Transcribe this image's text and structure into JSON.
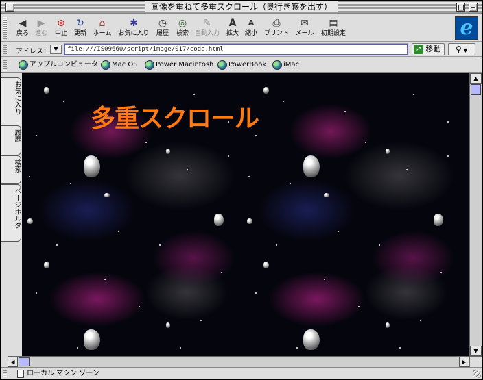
{
  "window": {
    "title": "画像を重ねて多重スクロール（奥行き感を出す）"
  },
  "toolbar": {
    "buttons": [
      {
        "label": "戻る",
        "icon": "back-arrow",
        "enabled": true
      },
      {
        "label": "進む",
        "icon": "forward-arrow",
        "enabled": false
      },
      {
        "label": "中止",
        "icon": "stop",
        "enabled": true
      },
      {
        "label": "更新",
        "icon": "refresh",
        "enabled": true
      },
      {
        "label": "ホーム",
        "icon": "home",
        "enabled": true
      },
      {
        "label": "お気に入り",
        "icon": "favorites",
        "enabled": true
      },
      {
        "label": "履歴",
        "icon": "history",
        "enabled": true
      },
      {
        "label": "検索",
        "icon": "search",
        "enabled": true
      },
      {
        "label": "自動入力",
        "icon": "autofill",
        "enabled": false
      },
      {
        "label": "拡大",
        "icon": "text-larger",
        "enabled": true
      },
      {
        "label": "縮小",
        "icon": "text-smaller",
        "enabled": true
      },
      {
        "label": "プリント",
        "icon": "print",
        "enabled": true
      },
      {
        "label": "メール",
        "icon": "mail",
        "enabled": true
      },
      {
        "label": "初期設定",
        "icon": "preferences",
        "enabled": true
      }
    ]
  },
  "address": {
    "label": "アドレス：",
    "url": "file:///IS09660/script/image/017/code.html",
    "go_label": "移動"
  },
  "favorites_bar": {
    "items": [
      "アップルコンピュータ",
      "Mac OS",
      "Power Macintosh",
      "PowerBook",
      "iMac"
    ]
  },
  "sidebar_tabs": [
    "お気に入り",
    "履歴",
    "検索",
    "ページホルダ"
  ],
  "page": {
    "heading": "多重スクロール",
    "heading_color": "#ff7a12"
  },
  "status": {
    "zone": "ローカル マシン ゾーン"
  }
}
